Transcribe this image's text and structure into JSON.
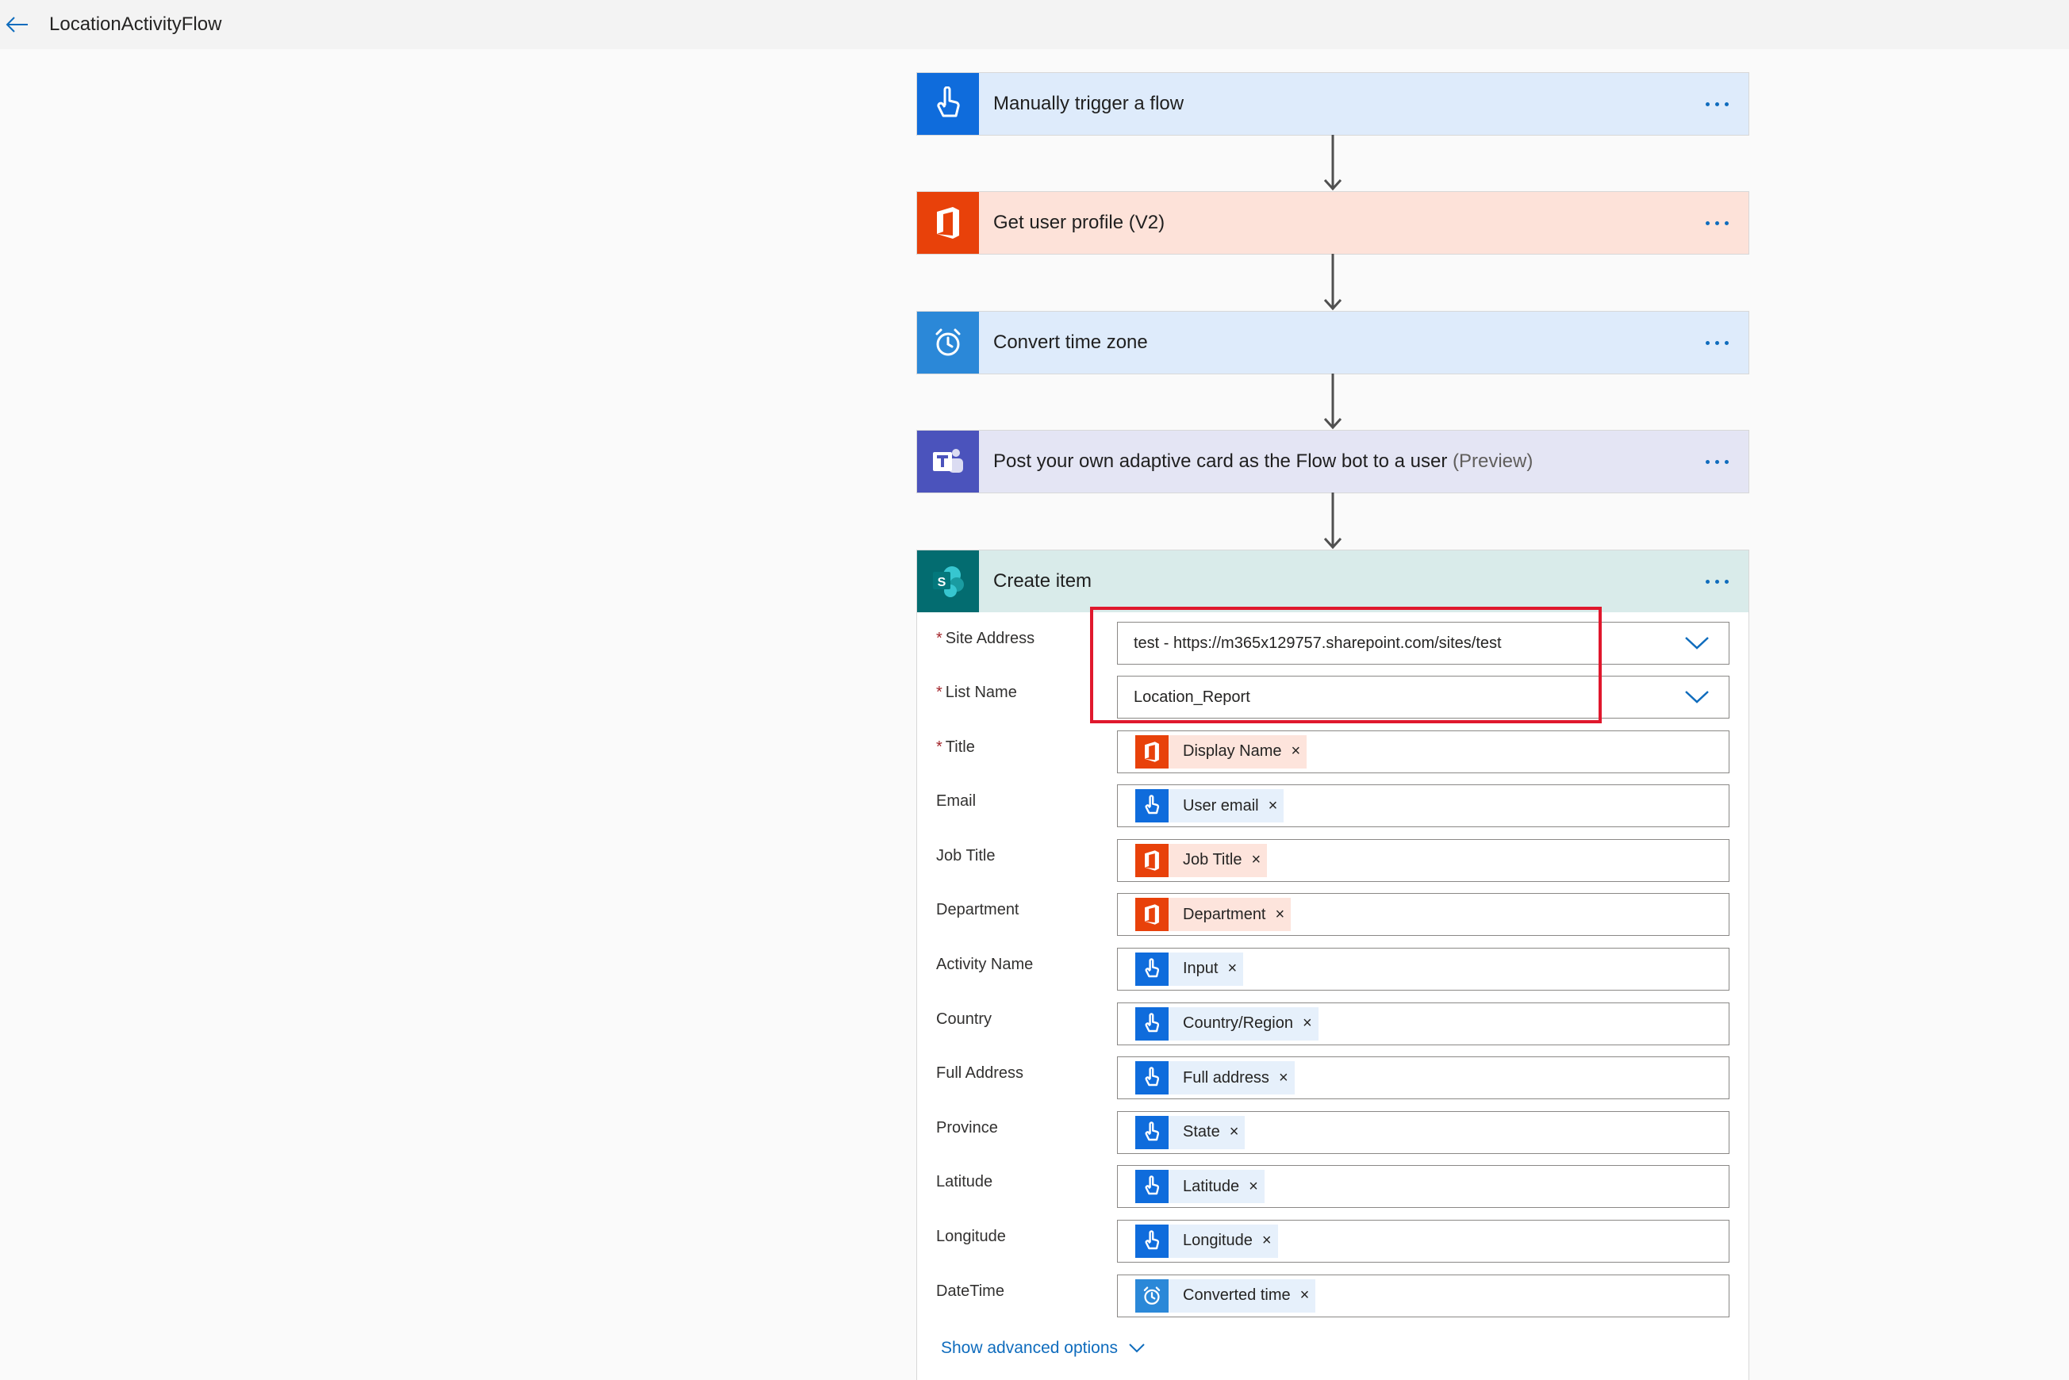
{
  "header": {
    "title": "LocationActivityFlow",
    "back_icon": "back-arrow-icon"
  },
  "steps": [
    {
      "title": "Manually trigger a flow",
      "subtitle": "",
      "icon": "touch-icon",
      "color": "#0f6cdc",
      "bg": "#deebfb"
    },
    {
      "title": "Get user profile (V2)",
      "subtitle": "",
      "icon": "office-icon",
      "color": "#e8410a",
      "bg": "#fde2d9"
    },
    {
      "title": "Convert time zone",
      "subtitle": "",
      "icon": "alarm-clock-icon",
      "color": "#2b88d8",
      "bg": "#deebfb"
    },
    {
      "title": "Post your own adaptive card as the Flow bot to a user",
      "subtitle": "(Preview)",
      "icon": "teams-icon",
      "color": "#4b53bc",
      "bg": "#e4e5f4"
    }
  ],
  "create_item": {
    "title": "Create item",
    "icon": "sharepoint-icon",
    "color": "#036c70",
    "bg": "#d9ebea",
    "fields": [
      {
        "label": "Site Address",
        "required": true,
        "type": "dropdown",
        "value": "test - https://m365x129757.sharepoint.com/sites/test"
      },
      {
        "label": "List Name",
        "required": true,
        "type": "dropdown",
        "value": "Location_Report"
      },
      {
        "label": "Title",
        "required": true,
        "type": "token",
        "token": "Display Name",
        "source": "office"
      },
      {
        "label": "Email",
        "required": false,
        "type": "token",
        "token": "User email",
        "source": "trigger"
      },
      {
        "label": "Job Title",
        "required": false,
        "type": "token",
        "token": "Job Title",
        "source": "office"
      },
      {
        "label": "Department",
        "required": false,
        "type": "token",
        "token": "Department",
        "source": "office"
      },
      {
        "label": "Activity Name",
        "required": false,
        "type": "token",
        "token": "Input",
        "source": "trigger"
      },
      {
        "label": "Country",
        "required": false,
        "type": "token",
        "token": "Country/Region",
        "source": "trigger"
      },
      {
        "label": "Full Address",
        "required": false,
        "type": "token",
        "token": "Full address",
        "source": "trigger"
      },
      {
        "label": "Province",
        "required": false,
        "type": "token",
        "token": "State",
        "source": "trigger"
      },
      {
        "label": "Latitude",
        "required": false,
        "type": "token",
        "token": "Latitude",
        "source": "trigger"
      },
      {
        "label": "Longitude",
        "required": false,
        "type": "token",
        "token": "Longitude",
        "source": "trigger"
      },
      {
        "label": "DateTime",
        "required": false,
        "type": "token",
        "token": "Converted time",
        "source": "clock"
      }
    ],
    "advanced_label": "Show advanced options"
  },
  "token_remove_glyph": "×",
  "required_marker": "*"
}
